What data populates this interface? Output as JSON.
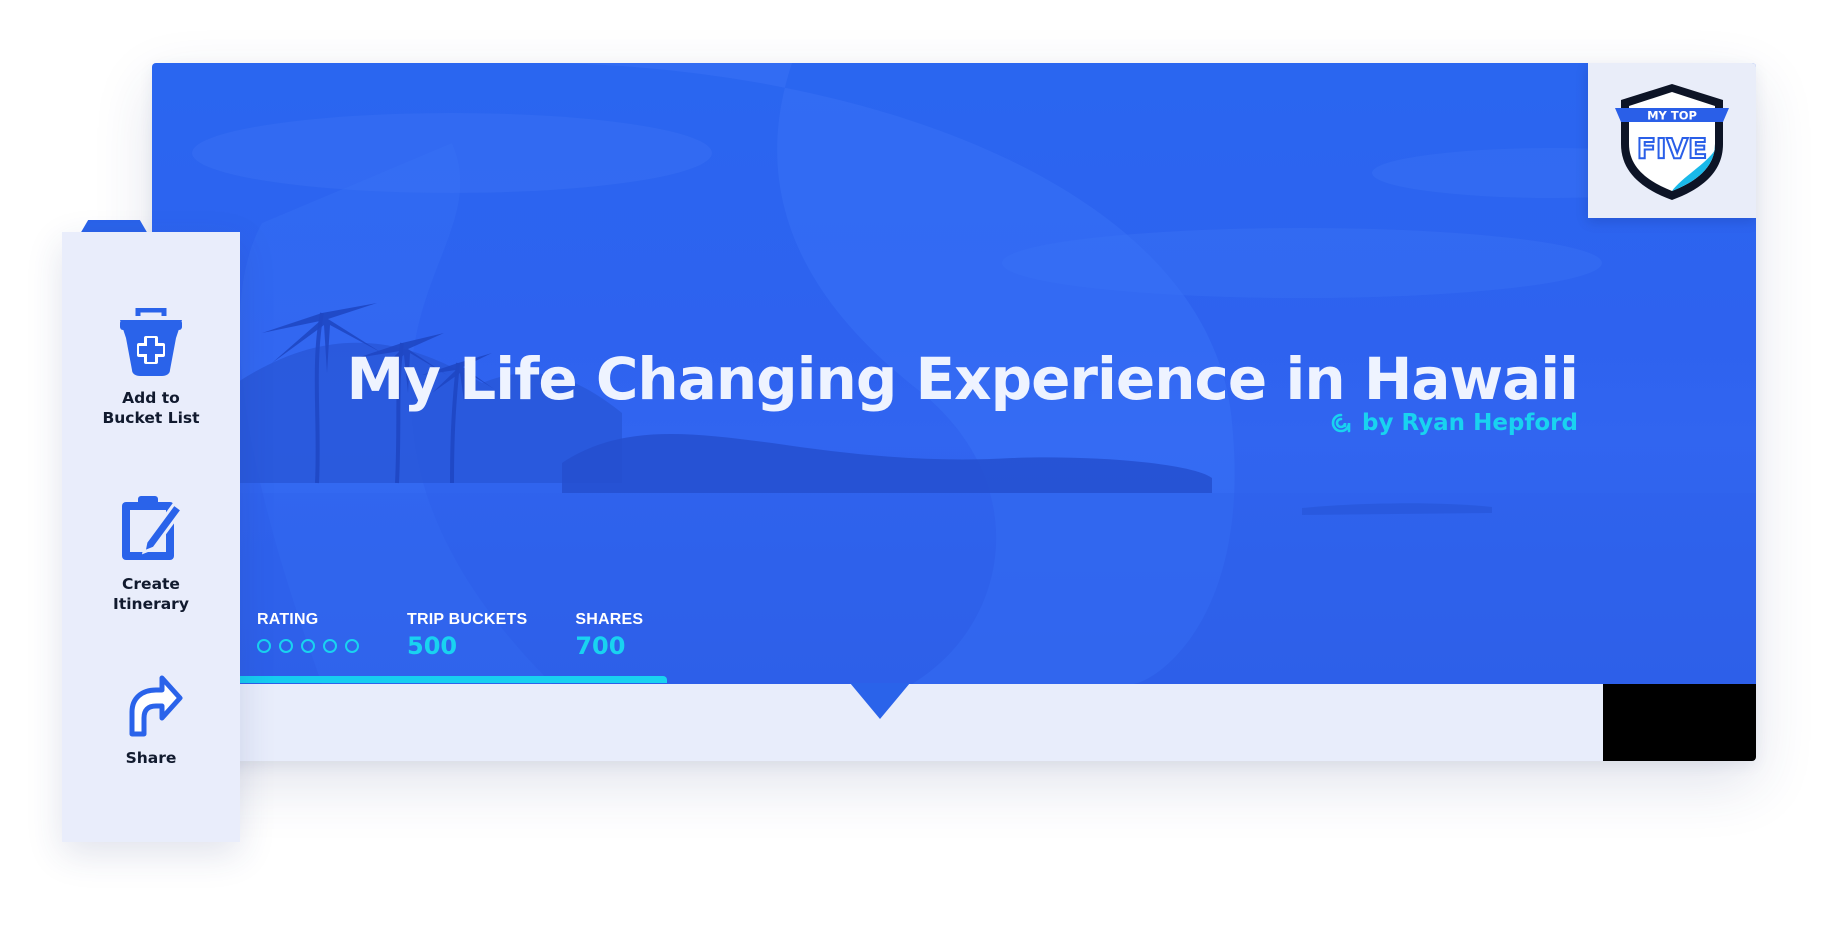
{
  "hero": {
    "title": "My Life Changing Experience in Hawaii",
    "author": "by Ryan Hepford",
    "stats": {
      "rating_label": "RATING",
      "rating_value": 0,
      "rating_max": 5,
      "trip_buckets_label": "TRIP BUCKETS",
      "trip_buckets_value": "500",
      "shares_label": "SHARES",
      "shares_value": "700"
    },
    "accent_color": "#19d3f0",
    "hero_color": "#2f64ee"
  },
  "badge": {
    "line1": "MY TOP",
    "line2": "FIVE"
  },
  "sidebar": {
    "items": [
      {
        "label_line1": "Add to",
        "label_line2": "Bucket List",
        "icon": "basket-add-icon"
      },
      {
        "label_line1": "Create",
        "label_line2": "Itinerary",
        "icon": "clipboard-edit-icon"
      },
      {
        "label_line1": "Share",
        "icon": "share-arrow-icon"
      }
    ]
  }
}
